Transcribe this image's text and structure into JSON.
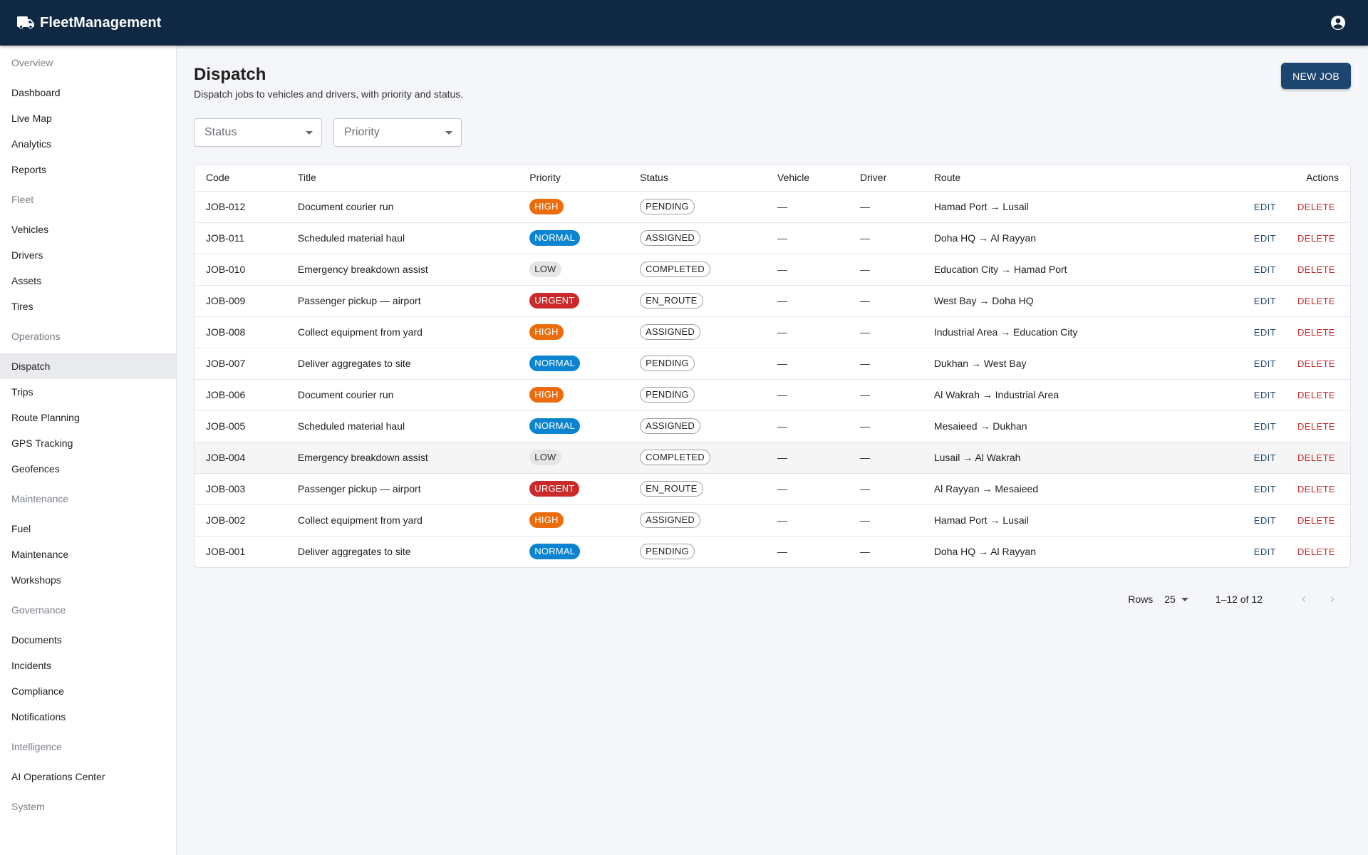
{
  "app": {
    "title": "FleetManagement"
  },
  "sidebar": {
    "sections": [
      {
        "label": "Overview",
        "items": [
          "Dashboard",
          "Live Map",
          "Analytics",
          "Reports"
        ]
      },
      {
        "label": "Fleet",
        "items": [
          "Vehicles",
          "Drivers",
          "Assets",
          "Tires"
        ]
      },
      {
        "label": "Operations",
        "items": [
          "Dispatch",
          "Trips",
          "Route Planning",
          "GPS Tracking",
          "Geofences"
        ]
      },
      {
        "label": "Maintenance",
        "items": [
          "Fuel",
          "Maintenance",
          "Workshops"
        ]
      },
      {
        "label": "Governance",
        "items": [
          "Documents",
          "Incidents",
          "Compliance",
          "Notifications"
        ]
      },
      {
        "label": "Intelligence",
        "items": [
          "AI Operations Center"
        ]
      },
      {
        "label": "System",
        "items": []
      }
    ],
    "active": "Dispatch"
  },
  "page": {
    "title": "Dispatch",
    "subtitle": "Dispatch jobs to vehicles and drivers, with priority and status.",
    "new_button": "NEW JOB"
  },
  "filters": {
    "status_placeholder": "Status",
    "priority_placeholder": "Priority"
  },
  "table": {
    "columns": {
      "code": "Code",
      "title": "Title",
      "priority": "Priority",
      "status": "Status",
      "vehicle": "Vehicle",
      "driver": "Driver",
      "route": "Route",
      "actions": "Actions"
    },
    "edit_label": "EDIT",
    "delete_label": "DELETE",
    "rows": [
      {
        "code": "JOB-012",
        "title": "Document courier run",
        "priority": "HIGH",
        "status": "PENDING",
        "vehicle": "—",
        "driver": "—",
        "route": "Hamad Port → Lusail"
      },
      {
        "code": "JOB-011",
        "title": "Scheduled material haul",
        "priority": "NORMAL",
        "status": "ASSIGNED",
        "vehicle": "—",
        "driver": "—",
        "route": "Doha HQ → Al Rayyan"
      },
      {
        "code": "JOB-010",
        "title": "Emergency breakdown assist",
        "priority": "LOW",
        "status": "COMPLETED",
        "vehicle": "—",
        "driver": "—",
        "route": "Education City → Hamad Port"
      },
      {
        "code": "JOB-009",
        "title": "Passenger pickup — airport",
        "priority": "URGENT",
        "status": "EN_ROUTE",
        "vehicle": "—",
        "driver": "—",
        "route": "West Bay → Doha HQ"
      },
      {
        "code": "JOB-008",
        "title": "Collect equipment from yard",
        "priority": "HIGH",
        "status": "ASSIGNED",
        "vehicle": "—",
        "driver": "—",
        "route": "Industrial Area → Education City"
      },
      {
        "code": "JOB-007",
        "title": "Deliver aggregates to site",
        "priority": "NORMAL",
        "status": "PENDING",
        "vehicle": "—",
        "driver": "—",
        "route": "Dukhan → West Bay"
      },
      {
        "code": "JOB-006",
        "title": "Document courier run",
        "priority": "HIGH",
        "status": "PENDING",
        "vehicle": "—",
        "driver": "—",
        "route": "Al Wakrah → Industrial Area"
      },
      {
        "code": "JOB-005",
        "title": "Scheduled material haul",
        "priority": "NORMAL",
        "status": "ASSIGNED",
        "vehicle": "—",
        "driver": "—",
        "route": "Mesaieed → Dukhan"
      },
      {
        "code": "JOB-004",
        "title": "Emergency breakdown assist",
        "priority": "LOW",
        "status": "COMPLETED",
        "vehicle": "—",
        "driver": "—",
        "route": "Lusail → Al Wakrah"
      },
      {
        "code": "JOB-003",
        "title": "Passenger pickup — airport",
        "priority": "URGENT",
        "status": "EN_ROUTE",
        "vehicle": "—",
        "driver": "—",
        "route": "Al Rayyan → Mesaieed"
      },
      {
        "code": "JOB-002",
        "title": "Collect equipment from yard",
        "priority": "HIGH",
        "status": "ASSIGNED",
        "vehicle": "—",
        "driver": "—",
        "route": "Hamad Port → Lusail"
      },
      {
        "code": "JOB-001",
        "title": "Deliver aggregates to site",
        "priority": "NORMAL",
        "status": "PENDING",
        "vehicle": "—",
        "driver": "—",
        "route": "Doha HQ → Al Rayyan"
      }
    ]
  },
  "pagination": {
    "rows_label": "Rows",
    "rows_per_page": "25",
    "range": "1–12 of 12"
  },
  "icons": {
    "brand": "truck-icon",
    "account": "account-circle-icon",
    "prev": "chevron-left-icon",
    "next": "chevron-right-icon"
  },
  "colors": {
    "appbar": "#0f2944",
    "primary": "#1d4670",
    "high": "#ec6c0b",
    "normal": "#0a84d0",
    "urgent": "#cc2a2a",
    "delete": "#c62828"
  }
}
